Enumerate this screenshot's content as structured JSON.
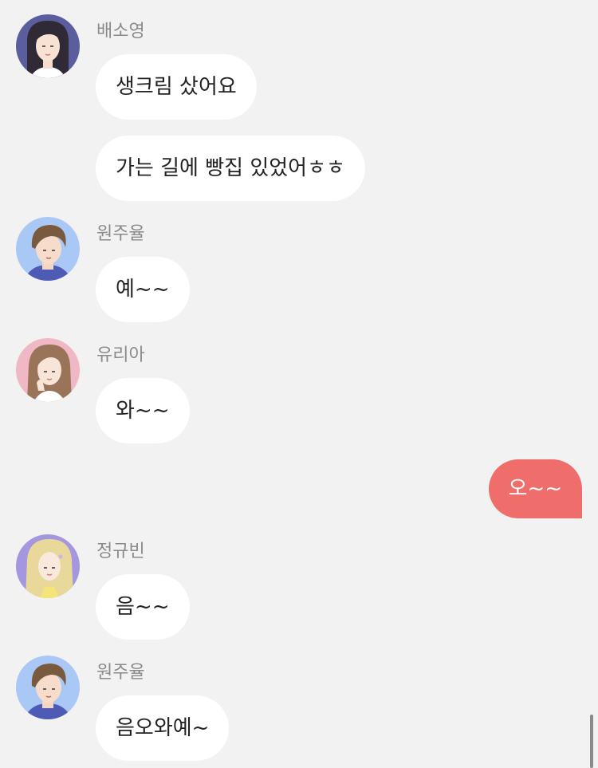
{
  "colors": {
    "background": "#f2f2f2",
    "bubble_incoming": "#ffffff",
    "bubble_outgoing": "#ef6e6c",
    "sender_name": "#8a8a8a",
    "text": "#222222"
  },
  "chat": {
    "messages": [
      {
        "sender": "배소영",
        "avatar": "woman-dark-hair-avatar",
        "texts": [
          "생크림 샀어요",
          "가는 길에 빵집 있었어ㅎㅎ"
        ]
      },
      {
        "sender": "원주율",
        "avatar": "man-brown-hair-avatar",
        "texts": [
          "예~~"
        ]
      },
      {
        "sender": "유리아",
        "avatar": "woman-long-brown-hair-avatar",
        "texts": [
          "와~~"
        ]
      },
      {
        "mine": true,
        "texts": [
          "오~~"
        ]
      },
      {
        "sender": "정규빈",
        "avatar": "woman-blonde-curly-hair-avatar",
        "texts": [
          "음~~"
        ]
      },
      {
        "sender": "원주율",
        "avatar": "man-brown-hair-avatar",
        "texts": [
          "음오와예~"
        ]
      }
    ]
  }
}
